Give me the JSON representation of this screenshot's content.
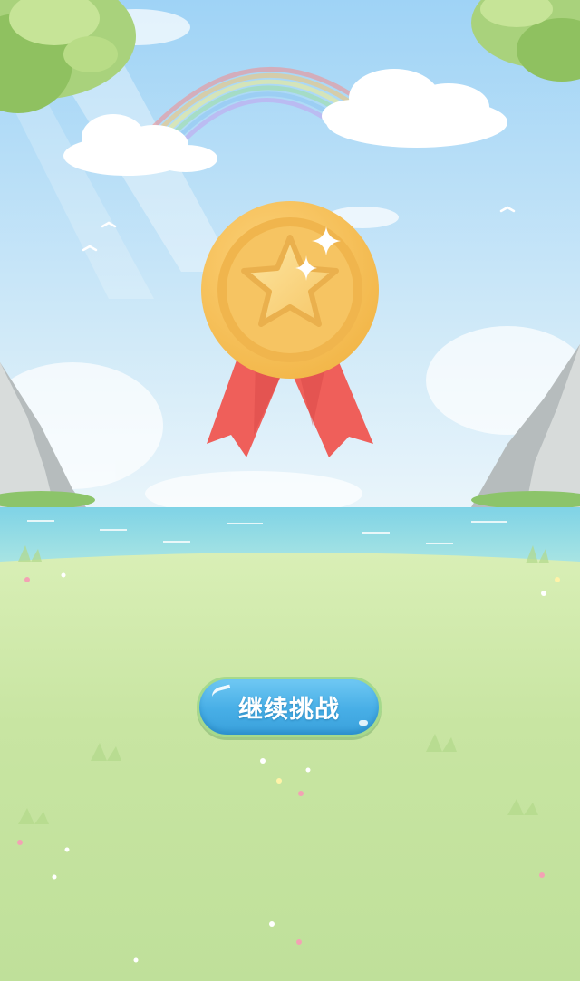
{
  "result": {
    "continue_label": "继续挑战"
  },
  "icons": {
    "medal": "medal-icon",
    "star": "star-icon",
    "sparkle": "sparkle-icon"
  },
  "colors": {
    "sky_top": "#a9d8f7",
    "sky_bottom": "#e6f4fb",
    "sea": "#8fdbe8",
    "grass": "#c9e6a6",
    "medal_gold": "#f7c25c",
    "ribbon_red": "#ef5f5a",
    "button_blue": "#47aee6"
  }
}
